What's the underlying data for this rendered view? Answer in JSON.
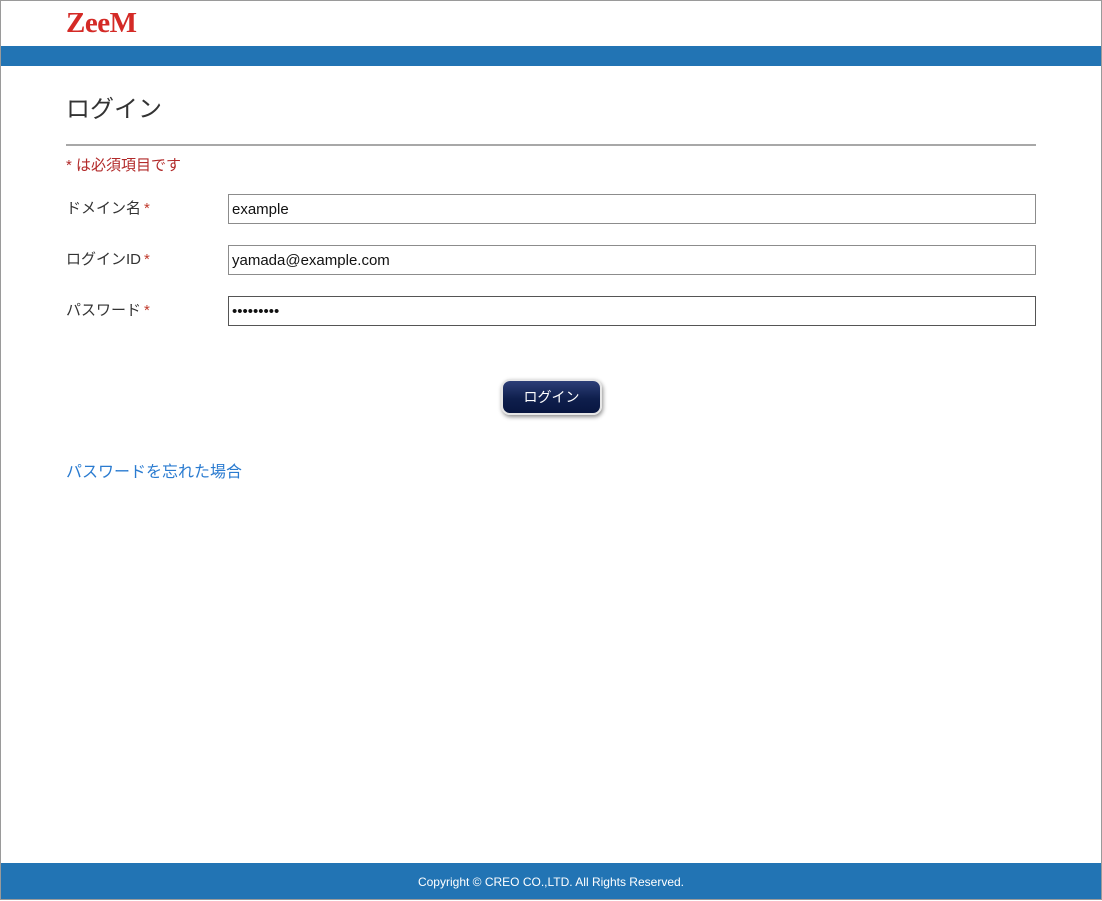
{
  "header": {
    "logo_text": "ZeeM",
    "brand_color": "#d42a26",
    "bar_color": "#2274b4"
  },
  "page": {
    "title": "ログイン",
    "required_note": "* は必須項目です"
  },
  "form": {
    "required_marker": "*",
    "fields": [
      {
        "label": "ドメイン名",
        "value": "example",
        "type": "text"
      },
      {
        "label": "ログインID",
        "value": "yamada@example.com",
        "type": "text"
      },
      {
        "label": "パスワード",
        "value": "•••••••••",
        "type": "password"
      }
    ],
    "submit_label": "ログイン"
  },
  "links": {
    "forgot_password": "パスワードを忘れた場合"
  },
  "footer": {
    "copyright": "Copyright © CREO CO.,LTD. All Rights Reserved."
  }
}
